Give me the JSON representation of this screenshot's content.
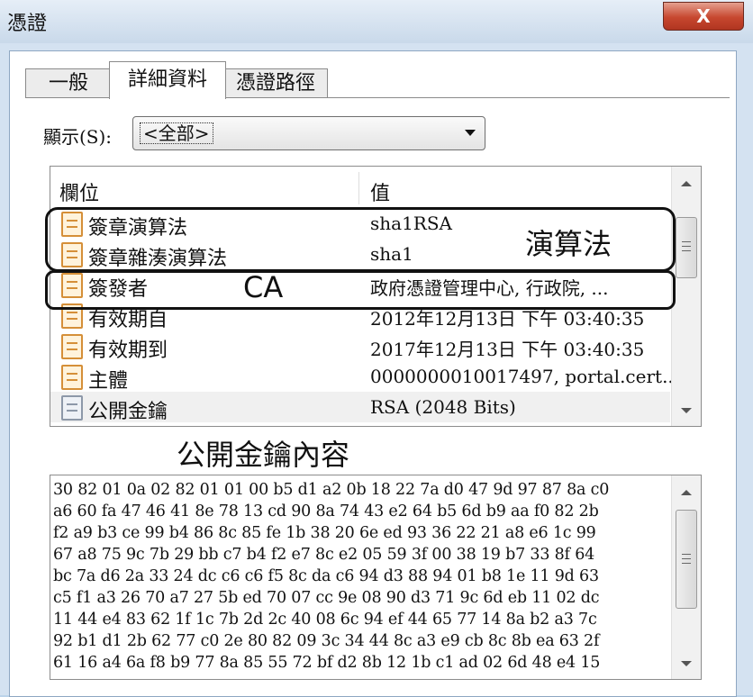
{
  "window": {
    "title": "憑證",
    "close_label": "X"
  },
  "tabs": [
    {
      "label": "一般",
      "active": false
    },
    {
      "label": "詳細資料",
      "active": true
    },
    {
      "label": "憑證路徑",
      "active": false
    }
  ],
  "show": {
    "label": "顯示(S):",
    "selected": "<全部>"
  },
  "field_list": {
    "columns": [
      "欄位",
      "值"
    ],
    "rows": [
      {
        "field": "簽章演算法",
        "value": "sha1RSA",
        "icon": "certificate-field-icon"
      },
      {
        "field": "簽章雜湊演算法",
        "value": "sha1",
        "icon": "certificate-field-icon"
      },
      {
        "field": "簽發者",
        "value": "政府憑證管理中心, 行政院, ...",
        "icon": "certificate-field-icon"
      },
      {
        "field": "有效期自",
        "value": "2012年12月13日 下午 03:40:35",
        "icon": "certificate-field-icon"
      },
      {
        "field": "有效期到",
        "value": "2017年12月13日 下午 03:40:35",
        "icon": "certificate-field-icon"
      },
      {
        "field": "主體",
        "value": "0000000010017497, portal.cert...",
        "icon": "certificate-field-icon"
      },
      {
        "field": "公開金鑰",
        "value": "RSA (2048 Bits)",
        "icon": "public-key-field-icon",
        "selected": true
      }
    ]
  },
  "annotations": {
    "algorithm": "演算法",
    "ca": "CA",
    "public_key_content": "公開金鑰內容"
  },
  "key_hex": [
    "30 82 01 0a 02 82 01 01 00 b5 d1 a2 0b 18 22 7a d0 47 9d 97 87 8a c0",
    "a6 60 fa 47 46 41 8e 78 13 cd 90 8a 74 43 e2 64 b5 6d b9 aa f0 82 2b",
    "f2 a9 b3 ce 99 b4 86 8c 85 fe 1b 38 20 6e ed 93 36 22 21 a8 e6 1c 99",
    "67 a8 75 9c 7b 29 bb c7 b4 f2 e7 8c e2 05 59 3f 00 38 19 b7 33 8f 64",
    "bc 7a d6 2a 33 24 dc c6 c6 f5 8c da c6 94 d3 88 94 01 b8 1e 11 9d 63",
    "c5 f1 a3 26 70 a7 27 5b ed 70 07 cc 9e 08 90 d3 71 9c 6d eb 11 02 dc",
    "11 44 e4 83 62 1f 1c 7b 2d 2c 40 08 6c 94 ef 44 65 77 14 8a b2 a3 7c",
    "92 b1 d1 2b 62 77 c0 2e 80 82 09 3c 34 44 8c a3 e9 cb 8c 8b ea 63 2f",
    "61 16 a4 6a f8 b9 77 8a 85 55 72 bf d2 8b 12 1b c1 ad 02 6d 48 e4 15"
  ]
}
